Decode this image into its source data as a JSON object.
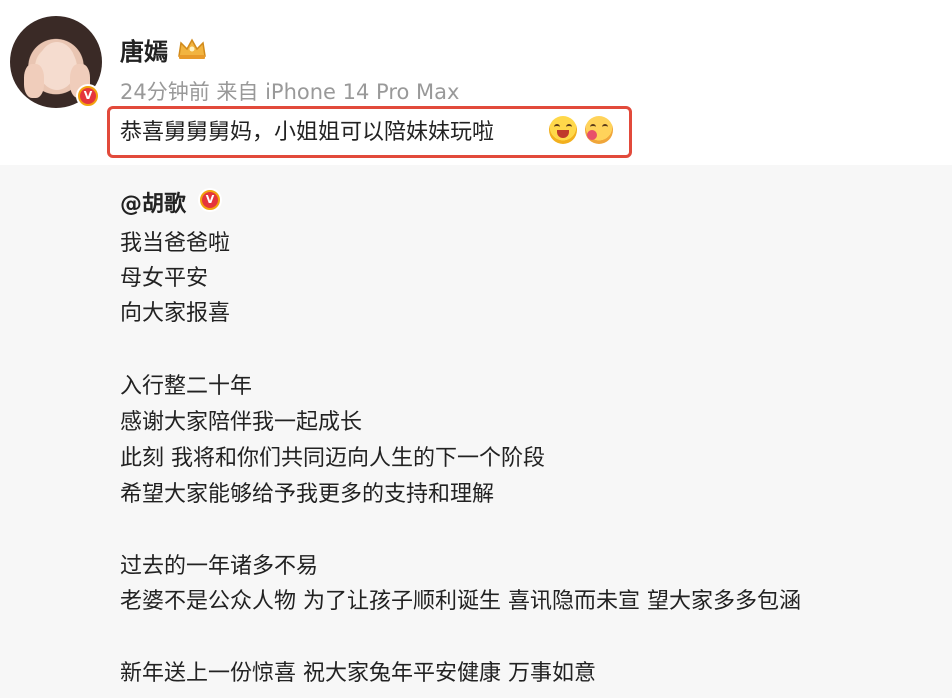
{
  "post": {
    "username": "唐嫣",
    "timestamp": "24分钟前",
    "source": "来自 iPhone 14 Pro Max",
    "comment": "恭喜舅舅舅妈，小姐姐可以陪妹妹玩啦"
  },
  "repost": {
    "author": "@胡歌",
    "lines": [
      "我当爸爸啦",
      "母女平安",
      "向大家报喜",
      "入行整二十年",
      "感谢大家陪伴我一起成长",
      "此刻 我将和你们共同迈向人生的下一个阶段",
      "希望大家能够给予我更多的支持和理解",
      "过去的一年诸多不易",
      "老婆不是公众人物 为了让孩子顺利诞生 喜讯隐而未宣 望大家多多包涵",
      "新年送上一份惊喜 祝大家兔年平安健康 万事如意"
    ]
  },
  "colors": {
    "highlight_border": "#e24a3b",
    "meta_text": "#999999",
    "repost_bg": "#f7f7f7",
    "verified_badge": "#f2a20f"
  },
  "icons": {
    "verified": "verified-v-icon",
    "member_crown": "crown-icon",
    "emoji_1": "laugh-cry-emoji",
    "emoji_2": "blow-kiss-emoji"
  }
}
